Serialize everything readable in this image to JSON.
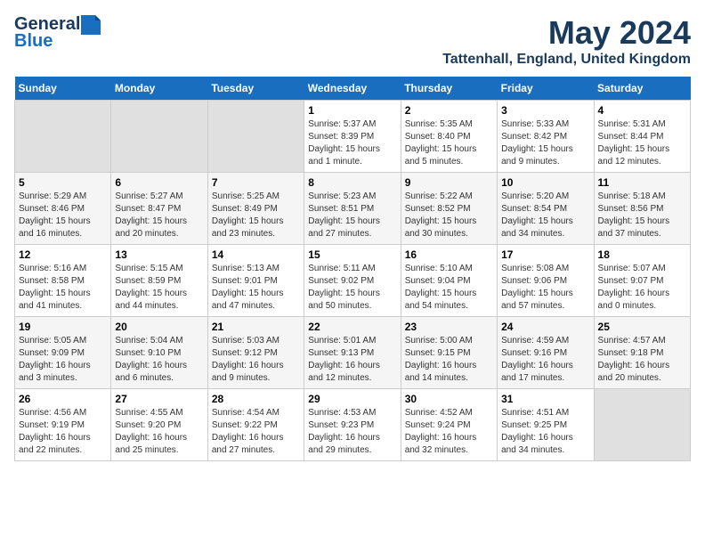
{
  "header": {
    "logo_general": "General",
    "logo_blue": "Blue",
    "month": "May 2024",
    "location": "Tattenhall, England, United Kingdom"
  },
  "days_of_week": [
    "Sunday",
    "Monday",
    "Tuesday",
    "Wednesday",
    "Thursday",
    "Friday",
    "Saturday"
  ],
  "weeks": [
    [
      {
        "date": "",
        "info": ""
      },
      {
        "date": "",
        "info": ""
      },
      {
        "date": "",
        "info": ""
      },
      {
        "date": "1",
        "info": "Sunrise: 5:37 AM\nSunset: 8:39 PM\nDaylight: 15 hours\nand 1 minute."
      },
      {
        "date": "2",
        "info": "Sunrise: 5:35 AM\nSunset: 8:40 PM\nDaylight: 15 hours\nand 5 minutes."
      },
      {
        "date": "3",
        "info": "Sunrise: 5:33 AM\nSunset: 8:42 PM\nDaylight: 15 hours\nand 9 minutes."
      },
      {
        "date": "4",
        "info": "Sunrise: 5:31 AM\nSunset: 8:44 PM\nDaylight: 15 hours\nand 12 minutes."
      }
    ],
    [
      {
        "date": "5",
        "info": "Sunrise: 5:29 AM\nSunset: 8:46 PM\nDaylight: 15 hours\nand 16 minutes."
      },
      {
        "date": "6",
        "info": "Sunrise: 5:27 AM\nSunset: 8:47 PM\nDaylight: 15 hours\nand 20 minutes."
      },
      {
        "date": "7",
        "info": "Sunrise: 5:25 AM\nSunset: 8:49 PM\nDaylight: 15 hours\nand 23 minutes."
      },
      {
        "date": "8",
        "info": "Sunrise: 5:23 AM\nSunset: 8:51 PM\nDaylight: 15 hours\nand 27 minutes."
      },
      {
        "date": "9",
        "info": "Sunrise: 5:22 AM\nSunset: 8:52 PM\nDaylight: 15 hours\nand 30 minutes."
      },
      {
        "date": "10",
        "info": "Sunrise: 5:20 AM\nSunset: 8:54 PM\nDaylight: 15 hours\nand 34 minutes."
      },
      {
        "date": "11",
        "info": "Sunrise: 5:18 AM\nSunset: 8:56 PM\nDaylight: 15 hours\nand 37 minutes."
      }
    ],
    [
      {
        "date": "12",
        "info": "Sunrise: 5:16 AM\nSunset: 8:58 PM\nDaylight: 15 hours\nand 41 minutes."
      },
      {
        "date": "13",
        "info": "Sunrise: 5:15 AM\nSunset: 8:59 PM\nDaylight: 15 hours\nand 44 minutes."
      },
      {
        "date": "14",
        "info": "Sunrise: 5:13 AM\nSunset: 9:01 PM\nDaylight: 15 hours\nand 47 minutes."
      },
      {
        "date": "15",
        "info": "Sunrise: 5:11 AM\nSunset: 9:02 PM\nDaylight: 15 hours\nand 50 minutes."
      },
      {
        "date": "16",
        "info": "Sunrise: 5:10 AM\nSunset: 9:04 PM\nDaylight: 15 hours\nand 54 minutes."
      },
      {
        "date": "17",
        "info": "Sunrise: 5:08 AM\nSunset: 9:06 PM\nDaylight: 15 hours\nand 57 minutes."
      },
      {
        "date": "18",
        "info": "Sunrise: 5:07 AM\nSunset: 9:07 PM\nDaylight: 16 hours\nand 0 minutes."
      }
    ],
    [
      {
        "date": "19",
        "info": "Sunrise: 5:05 AM\nSunset: 9:09 PM\nDaylight: 16 hours\nand 3 minutes."
      },
      {
        "date": "20",
        "info": "Sunrise: 5:04 AM\nSunset: 9:10 PM\nDaylight: 16 hours\nand 6 minutes."
      },
      {
        "date": "21",
        "info": "Sunrise: 5:03 AM\nSunset: 9:12 PM\nDaylight: 16 hours\nand 9 minutes."
      },
      {
        "date": "22",
        "info": "Sunrise: 5:01 AM\nSunset: 9:13 PM\nDaylight: 16 hours\nand 12 minutes."
      },
      {
        "date": "23",
        "info": "Sunrise: 5:00 AM\nSunset: 9:15 PM\nDaylight: 16 hours\nand 14 minutes."
      },
      {
        "date": "24",
        "info": "Sunrise: 4:59 AM\nSunset: 9:16 PM\nDaylight: 16 hours\nand 17 minutes."
      },
      {
        "date": "25",
        "info": "Sunrise: 4:57 AM\nSunset: 9:18 PM\nDaylight: 16 hours\nand 20 minutes."
      }
    ],
    [
      {
        "date": "26",
        "info": "Sunrise: 4:56 AM\nSunset: 9:19 PM\nDaylight: 16 hours\nand 22 minutes."
      },
      {
        "date": "27",
        "info": "Sunrise: 4:55 AM\nSunset: 9:20 PM\nDaylight: 16 hours\nand 25 minutes."
      },
      {
        "date": "28",
        "info": "Sunrise: 4:54 AM\nSunset: 9:22 PM\nDaylight: 16 hours\nand 27 minutes."
      },
      {
        "date": "29",
        "info": "Sunrise: 4:53 AM\nSunset: 9:23 PM\nDaylight: 16 hours\nand 29 minutes."
      },
      {
        "date": "30",
        "info": "Sunrise: 4:52 AM\nSunset: 9:24 PM\nDaylight: 16 hours\nand 32 minutes."
      },
      {
        "date": "31",
        "info": "Sunrise: 4:51 AM\nSunset: 9:25 PM\nDaylight: 16 hours\nand 34 minutes."
      },
      {
        "date": "",
        "info": ""
      }
    ]
  ]
}
